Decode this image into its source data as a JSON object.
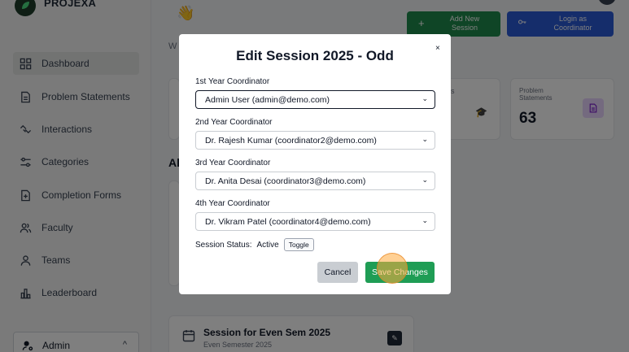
{
  "brand": {
    "name": "PROJEXA"
  },
  "sidebar": {
    "items": [
      {
        "label": "Dashboard",
        "icon": "dashboard-grid-icon",
        "active": true
      },
      {
        "label": "Problem Statements",
        "icon": "document-icon"
      },
      {
        "label": "Interactions",
        "icon": "handshake-icon"
      },
      {
        "label": "Categories",
        "icon": "sliders-icon"
      },
      {
        "label": "Completion Forms",
        "icon": "file-plus-icon"
      },
      {
        "label": "Faculty",
        "icon": "users-icon"
      },
      {
        "label": "Teams",
        "icon": "user-icon"
      },
      {
        "label": "Leaderboard",
        "icon": "bar-chart-icon"
      }
    ],
    "user": {
      "label": "Admin",
      "icon": "user-cog-icon",
      "chevron": "^"
    }
  },
  "background": {
    "welcome_fragment": "W",
    "add_session": {
      "label": "Add New Session",
      "icon": "+"
    },
    "login_coordinator": {
      "label": "Login as Coordinator",
      "icon": "key-icon"
    },
    "stats": {
      "problem_statements": {
        "label": "Problem Statements",
        "value": "63"
      },
      "fragment_s": "s"
    },
    "all_fragment": "Al",
    "session_card": {
      "title": "Session for Even Sem 2025",
      "subtitle": "Even Semester 2025"
    }
  },
  "modal": {
    "title": "Edit Session 2025 - Odd",
    "close": "×",
    "fields": [
      {
        "label": "1st Year Coordinator",
        "value": "Admin User (admin@demo.com)"
      },
      {
        "label": "2nd Year Coordinator",
        "value": "Dr. Rajesh Kumar (coordinator2@demo.com)"
      },
      {
        "label": "3rd Year Coordinator",
        "value": "Dr. Anita Desai (coordinator3@demo.com)"
      },
      {
        "label": "4th Year Coordinator",
        "value": "Dr. Vikram Patel (coordinator4@demo.com)"
      }
    ],
    "status": {
      "label": "Session Status:",
      "value": "Active",
      "toggle": "Toggle"
    },
    "cancel": "Cancel",
    "save": "Save Changes"
  },
  "colors": {
    "accent_green": "#1f9d55",
    "brand_blue": "#2a5bd7",
    "overlay": "rgba(0,0,0,0.5)"
  }
}
